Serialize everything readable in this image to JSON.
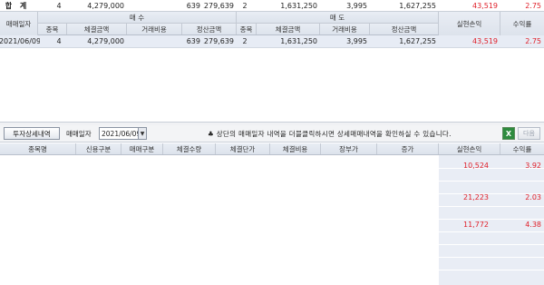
{
  "summary": {
    "label": "합 계",
    "buy_count": "4",
    "buy_amount": "4,279,000",
    "buy_fee": "639",
    "buy_settle": "4,279,639",
    "sell_count": "2",
    "sell_amount": "1,631,250",
    "sell_fee": "3,995",
    "sell_settle": "1,627,255",
    "profit": "43,519",
    "rate": "2.75"
  },
  "top_header": {
    "date": "매매일자",
    "buy_group": "매 수",
    "sell_group": "매 도",
    "profit": "실현손익",
    "rate": "수익률",
    "count": "종목",
    "amount": "체결금액",
    "fee": "거래비용",
    "settle": "정산금액"
  },
  "top_rows": [
    {
      "date": "2021/06/09",
      "buy_count": "4",
      "buy_amount": "4,279,000",
      "buy_fee": "639",
      "buy_settle": "4,279,639",
      "sell_count": "2",
      "sell_amount": "1,631,250",
      "sell_fee": "3,995",
      "sell_settle": "1,627,255",
      "profit": "43,519",
      "rate": "2.75"
    }
  ],
  "toolbar": {
    "detail_button": "투자상세내역",
    "date_label": "매매일자",
    "date_value": "2021/06/09",
    "notice": "♣ 상단의 매매일자 내역을 더블클릭하시면 상세매매내역을 확인하실 수 있습니다.",
    "excel_icon": "excel-icon",
    "next_button": "다음"
  },
  "bottom_header": {
    "stock": "종목명",
    "credit": "신용구분",
    "trade_type": "매매구분",
    "qty": "체결수량",
    "price": "체결단가",
    "fee": "체결비용",
    "book_price": "장부가",
    "diff": "증가",
    "profit": "실현손익",
    "rate": "수익률"
  },
  "bottom_rows": [
    {
      "profit": "10,524",
      "rate": "3.92"
    },
    {
      "profit": "",
      "rate": ""
    },
    {
      "profit": "",
      "rate": ""
    },
    {
      "profit": "21,223",
      "rate": "2.03"
    },
    {
      "profit": "",
      "rate": ""
    },
    {
      "profit": "11,772",
      "rate": "4.38"
    }
  ],
  "colors": {
    "negative_or_profit": "#e0202a",
    "header_bg": "#dde3ec",
    "selected_row_bg": "#e7ecf5"
  }
}
